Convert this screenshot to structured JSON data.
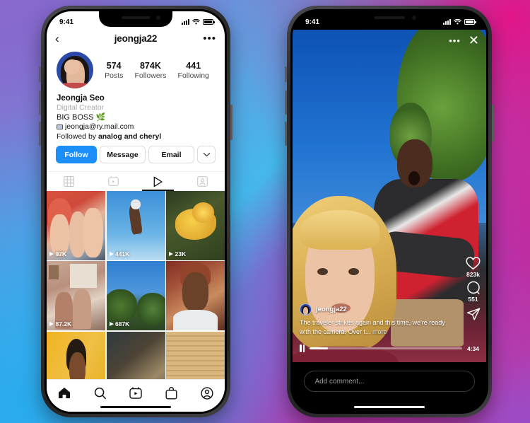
{
  "background": {
    "gradient_colors": [
      "#8a6fd0",
      "#28aaee",
      "#e71085",
      "#9650c8"
    ]
  },
  "left_phone": {
    "status_bar": {
      "time": "9:41",
      "signal_icon": "cellular-bars-icon",
      "wifi_icon": "wifi-icon",
      "battery_icon": "battery-icon"
    },
    "header": {
      "back_icon": "chevron-left-icon",
      "title": "jeongja22",
      "more_icon": "more-options-icon",
      "more_glyph": "•••"
    },
    "avatar": {
      "name": "profile-avatar"
    },
    "stats": [
      {
        "num": "574",
        "label": "Posts"
      },
      {
        "num": "874K",
        "label": "Followers"
      },
      {
        "num": "441",
        "label": "Following"
      }
    ],
    "bio": {
      "display_name": "Jeongja Seo",
      "category": "Digital Creator",
      "line1": "BIG BOSS 🌿",
      "email": "jeongja@ry.mail.com",
      "followed_prefix": "Followed by ",
      "followed_names": "analog and cheryl"
    },
    "buttons": {
      "follow": "Follow",
      "message": "Message",
      "email": "Email",
      "caret": "⌄"
    },
    "tabs": [
      {
        "name": "grid-tab",
        "icon": "grid-icon",
        "active": false
      },
      {
        "name": "reels-tab",
        "icon": "reels-icon",
        "active": false
      },
      {
        "name": "video-tab",
        "icon": "play-icon",
        "active": true
      },
      {
        "name": "tagged-tab",
        "icon": "tagged-person-icon",
        "active": false
      }
    ],
    "grid": [
      {
        "views": "97K",
        "theme": "friends-selfie"
      },
      {
        "views": "441K",
        "theme": "hand-sky"
      },
      {
        "views": "23K",
        "theme": "yellow-mushrooms"
      },
      {
        "views": "87.2K",
        "theme": "couple-indoor"
      },
      {
        "views": "687K",
        "theme": "trees-sky"
      },
      {
        "views": "",
        "theme": "portrait-woman"
      },
      {
        "views": "",
        "theme": "yellow-wall"
      },
      {
        "views": "",
        "theme": "dark-terrain"
      },
      {
        "views": "",
        "theme": "sand-texture"
      }
    ],
    "tabbar": [
      {
        "name": "home-tab",
        "icon": "home-icon"
      },
      {
        "name": "search-tab",
        "icon": "search-icon"
      },
      {
        "name": "reels-tab-nav",
        "icon": "reels-icon"
      },
      {
        "name": "shop-tab",
        "icon": "shop-bag-icon"
      },
      {
        "name": "profile-tab",
        "icon": "profile-circle-icon"
      }
    ]
  },
  "right_phone": {
    "status_bar": {
      "time": "9:41",
      "signal_icon": "cellular-bars-icon",
      "wifi_icon": "wifi-icon",
      "battery_icon": "battery-icon"
    },
    "reel_top": {
      "more_glyph": "•••",
      "close_glyph": "✕"
    },
    "actions": [
      {
        "name": "like-button",
        "icon": "heart-icon",
        "count": "823k"
      },
      {
        "name": "comment-button",
        "icon": "comment-bubble-icon",
        "count": "551"
      },
      {
        "name": "share-button",
        "icon": "share-paperplane-icon",
        "count": ""
      }
    ],
    "caption": {
      "username": "jeongja22",
      "text": "The traveler strikes again and this time, we're ready with the camera. Over t...",
      "more": " more"
    },
    "player": {
      "pause_icon": "pause-icon",
      "duration": "4:34",
      "progress_percent": 12
    },
    "comment_input": {
      "placeholder": "Add comment..."
    }
  }
}
